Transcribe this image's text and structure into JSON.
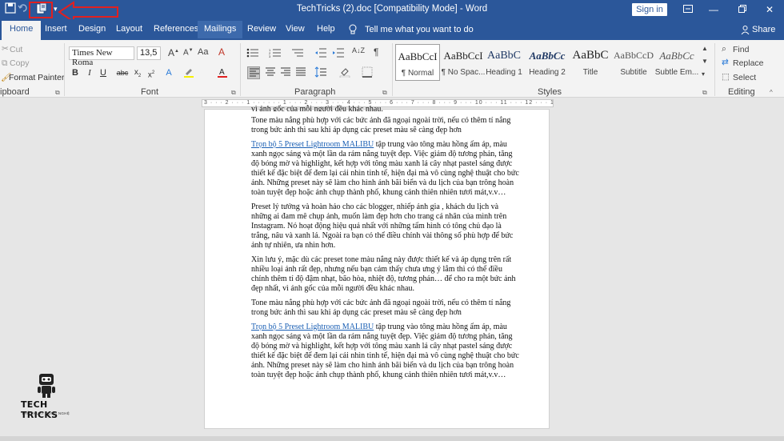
{
  "window": {
    "title": "TechTricks (2).doc [Compatibility Mode] - Word",
    "sign_in": "Sign in"
  },
  "tabs": [
    "Home",
    "Insert",
    "Design",
    "Layout",
    "References",
    "Mailings",
    "Review",
    "View",
    "Help"
  ],
  "tell_me": "Tell me what you want to do",
  "share": "Share",
  "clipboard": {
    "cut": "Cut",
    "copy": "Copy",
    "format_painter": "Format Painter",
    "label": "ipboard"
  },
  "font": {
    "name": "Times New Roma",
    "size": "13,5",
    "label": "Font"
  },
  "paragraph": {
    "label": "Paragraph"
  },
  "styles": {
    "label": "Styles",
    "items": [
      {
        "preview": "AaBbCcI",
        "name": "¶ Normal"
      },
      {
        "preview": "AaBbCcI",
        "name": "¶ No Spac..."
      },
      {
        "preview": "AaBbC",
        "name": "Heading 1"
      },
      {
        "preview": "AaBbCc",
        "name": "Heading 2"
      },
      {
        "preview": "AaBbC",
        "name": "Title"
      },
      {
        "preview": "AaBbCcD",
        "name": "Subtitle"
      },
      {
        "preview": "AaBbCc",
        "name": "Subtle Em..."
      }
    ]
  },
  "editing": {
    "find": "Find",
    "replace": "Replace",
    "select": "Select",
    "label": "Editing"
  },
  "ruler_text": "3 · · · 2 · · · 1 · · · · · · 1 · · · 2 · · · 3 · · · 4 · · · 5 · · · 6 · · · 7 · · · 8 · · · 9 · · · 10 · · · 11 · · · 12 · · · 13 · · · 14 · · · 15 · · · 16 · · 17 · · 18",
  "document": {
    "top_line": "vì ảnh gốc của mỗi người đều khác nhau.",
    "p1": "Tone màu nắng phù hợp với các bức ảnh đã ngoại ngoài trời, nếu có thêm tí nắng trong bức ảnh thì sau khi áp dụng các preset màu sẽ càng đẹp hơn",
    "p2_link": "Trọn bộ 5 Preset Lightroom MALIBU",
    "p2_rest": " tập trung vào tông màu hồng ấm áp, màu xanh ngọc sáng và một lần da rám nắng tuyệt đẹp. Việc giảm độ tương phản, tăng độ bóng mờ và highlight, kết hợp với tông màu xanh lá cây nhạt pastel sáng được thiết kế đặc biệt để đem lại cái nhìn tinh tế, hiện đại mà vô cùng nghệ thuật cho bức ảnh.  Những preset này sẽ làm cho hình ảnh bãi biển và du lịch của bạn trông hoàn toàn tuyệt đẹp hoặc ảnh chụp thành phố, khung cảnh thiên nhiên tươi mát,v.v…",
    "p3": "Preset lý tưởng và hoàn hảo cho các blogger, nhiếp ảnh gia , khách du lịch và những ai đam mê chụp ảnh, muốn làm đẹp hơn cho trang cá nhân của mình trên Instagram. Nó hoạt động hiệu quả nhất với những tấm hình có tông chủ đạo là trắng, nâu và xanh lá. Ngoài ra bạn có thể điều chỉnh vài thông số phù hợp để bức ảnh tự nhiên, ưa nhìn hơn.",
    "p4": "Xin lưu ý, mặc dù các preset tone màu nắng này được thiết kế và áp dụng trên rất nhiều loại ảnh rất đẹp, nhưng nếu bạn cảm thấy chưa ưng ý lắm thì có thể điều chỉnh thêm tí độ đậm nhạt, bão hòa, nhiệt độ, tương phản… để cho ra một bức ảnh đẹp nhất, vì ảnh gốc của mỗi người đều khác nhau.",
    "p5": "Tone màu nắng phù hợp với các bức ảnh đã ngoại ngoài trời, nếu có thêm tí nắng trong bức ảnh thì sau khi áp dụng các preset màu sẽ càng đẹp hơn",
    "p6_link": "Trọn bộ 5 Preset Lightroom MALIBU",
    "p6_rest": " tập trung vào tông màu hồng ấm áp, màu xanh ngọc sáng và một lần da rám nắng tuyệt đẹp. Việc giảm độ tương phản, tăng độ bóng mờ và highlight, kết hợp với tông màu xanh lá cây nhạt pastel sáng được thiết kế đặc biệt để đem lại cái nhìn tinh tế, hiện đại mà vô cùng nghệ thuật cho bức ảnh.  Những preset này sẽ làm cho hình ảnh bãi biển và du lịch của bạn trông hoàn toàn tuyệt đẹp hoặc ảnh chụp thành phố, khung cảnh thiên nhiên tươi mát,v.v…"
  },
  "logo": {
    "name": "TECH TRICKS",
    "tagline": "THỦ THUẬT CÔNG NGHỆ"
  },
  "colors": {
    "word_blue": "#2b579a",
    "annotation_red": "#e02020",
    "link_blue": "#1a5fb4"
  }
}
